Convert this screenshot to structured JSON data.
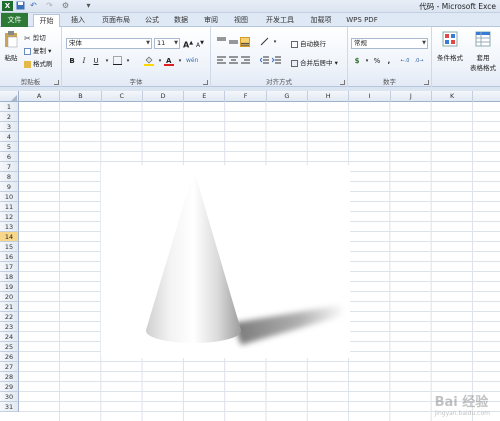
{
  "titlebar": {
    "title": "代码 - Microsoft Exce",
    "qat": [
      "excel-logo",
      "save",
      "undo",
      "redo",
      "quick-access-more"
    ]
  },
  "tabs": {
    "file": "文件",
    "home": "开始",
    "insert": "插入",
    "page_layout": "页面布局",
    "formulas": "公式",
    "data": "数据",
    "review": "审阅",
    "view": "视图",
    "developer": "开发工具",
    "addins": "加载项",
    "wps_pdf": "WPS PDF"
  },
  "ribbon": {
    "clipboard": {
      "paste": "粘贴",
      "cut": "剪切",
      "copy": "复制",
      "format_painter": "格式刷",
      "label": "剪贴板"
    },
    "font": {
      "name": "宋体",
      "size": "11",
      "bold": "B",
      "italic": "I",
      "underline": "U",
      "grow": "A",
      "shrink": "A",
      "phonetic": "wén",
      "label": "字体"
    },
    "alignment": {
      "wrap_text": "自动换行",
      "merge_center": "合并后居中",
      "label": "对齐方式"
    },
    "number": {
      "format": "常规",
      "currency": "$",
      "percent": "%",
      "comma": ",",
      "label": "数字"
    },
    "styles": {
      "conditional": "条件格式",
      "table_format_1": "套用",
      "table_format_2": "表格格式"
    }
  },
  "grid": {
    "columns": [
      "A",
      "B",
      "C",
      "D",
      "E",
      "F",
      "G",
      "H",
      "I",
      "J",
      "K"
    ],
    "rows": [
      "1",
      "2",
      "3",
      "4",
      "5",
      "6",
      "7",
      "8",
      "9",
      "10",
      "11",
      "12",
      "13",
      "14",
      "15",
      "16",
      "17",
      "18",
      "19",
      "20",
      "21",
      "22",
      "23",
      "24",
      "25",
      "26",
      "27",
      "28",
      "29",
      "30",
      "31"
    ],
    "selected_row": "14"
  },
  "watermark": {
    "text": "Bai 经验",
    "sub": "jingyan.baidu.com"
  },
  "colors": {
    "file_tab": "#2d7a36",
    "selected_row": "#f8d68a",
    "ribbon_border": "#b5c6dd"
  }
}
